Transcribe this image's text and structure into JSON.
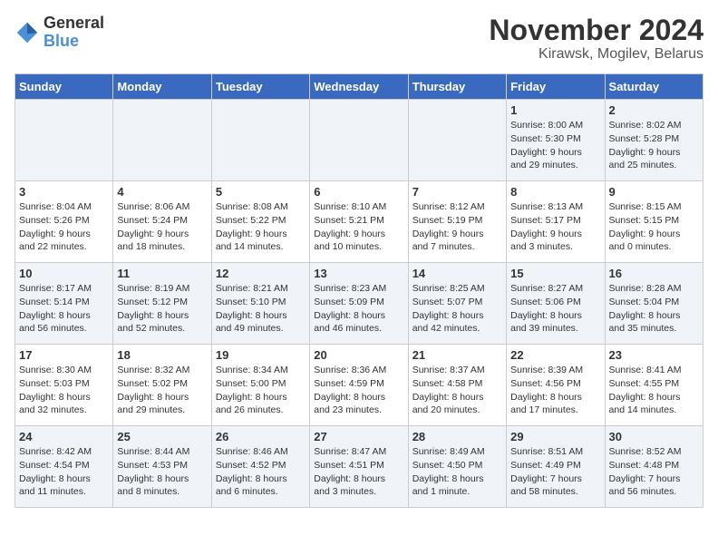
{
  "logo": {
    "general": "General",
    "blue": "Blue"
  },
  "title": {
    "month": "November 2024",
    "location": "Kirawsk, Mogilev, Belarus"
  },
  "weekdays": [
    "Sunday",
    "Monday",
    "Tuesday",
    "Wednesday",
    "Thursday",
    "Friday",
    "Saturday"
  ],
  "weeks": [
    [
      {
        "day": "",
        "info": ""
      },
      {
        "day": "",
        "info": ""
      },
      {
        "day": "",
        "info": ""
      },
      {
        "day": "",
        "info": ""
      },
      {
        "day": "",
        "info": ""
      },
      {
        "day": "1",
        "info": "Sunrise: 8:00 AM\nSunset: 5:30 PM\nDaylight: 9 hours\nand 29 minutes."
      },
      {
        "day": "2",
        "info": "Sunrise: 8:02 AM\nSunset: 5:28 PM\nDaylight: 9 hours\nand 25 minutes."
      }
    ],
    [
      {
        "day": "3",
        "info": "Sunrise: 8:04 AM\nSunset: 5:26 PM\nDaylight: 9 hours\nand 22 minutes."
      },
      {
        "day": "4",
        "info": "Sunrise: 8:06 AM\nSunset: 5:24 PM\nDaylight: 9 hours\nand 18 minutes."
      },
      {
        "day": "5",
        "info": "Sunrise: 8:08 AM\nSunset: 5:22 PM\nDaylight: 9 hours\nand 14 minutes."
      },
      {
        "day": "6",
        "info": "Sunrise: 8:10 AM\nSunset: 5:21 PM\nDaylight: 9 hours\nand 10 minutes."
      },
      {
        "day": "7",
        "info": "Sunrise: 8:12 AM\nSunset: 5:19 PM\nDaylight: 9 hours\nand 7 minutes."
      },
      {
        "day": "8",
        "info": "Sunrise: 8:13 AM\nSunset: 5:17 PM\nDaylight: 9 hours\nand 3 minutes."
      },
      {
        "day": "9",
        "info": "Sunrise: 8:15 AM\nSunset: 5:15 PM\nDaylight: 9 hours\nand 0 minutes."
      }
    ],
    [
      {
        "day": "10",
        "info": "Sunrise: 8:17 AM\nSunset: 5:14 PM\nDaylight: 8 hours\nand 56 minutes."
      },
      {
        "day": "11",
        "info": "Sunrise: 8:19 AM\nSunset: 5:12 PM\nDaylight: 8 hours\nand 52 minutes."
      },
      {
        "day": "12",
        "info": "Sunrise: 8:21 AM\nSunset: 5:10 PM\nDaylight: 8 hours\nand 49 minutes."
      },
      {
        "day": "13",
        "info": "Sunrise: 8:23 AM\nSunset: 5:09 PM\nDaylight: 8 hours\nand 46 minutes."
      },
      {
        "day": "14",
        "info": "Sunrise: 8:25 AM\nSunset: 5:07 PM\nDaylight: 8 hours\nand 42 minutes."
      },
      {
        "day": "15",
        "info": "Sunrise: 8:27 AM\nSunset: 5:06 PM\nDaylight: 8 hours\nand 39 minutes."
      },
      {
        "day": "16",
        "info": "Sunrise: 8:28 AM\nSunset: 5:04 PM\nDaylight: 8 hours\nand 35 minutes."
      }
    ],
    [
      {
        "day": "17",
        "info": "Sunrise: 8:30 AM\nSunset: 5:03 PM\nDaylight: 8 hours\nand 32 minutes."
      },
      {
        "day": "18",
        "info": "Sunrise: 8:32 AM\nSunset: 5:02 PM\nDaylight: 8 hours\nand 29 minutes."
      },
      {
        "day": "19",
        "info": "Sunrise: 8:34 AM\nSunset: 5:00 PM\nDaylight: 8 hours\nand 26 minutes."
      },
      {
        "day": "20",
        "info": "Sunrise: 8:36 AM\nSunset: 4:59 PM\nDaylight: 8 hours\nand 23 minutes."
      },
      {
        "day": "21",
        "info": "Sunrise: 8:37 AM\nSunset: 4:58 PM\nDaylight: 8 hours\nand 20 minutes."
      },
      {
        "day": "22",
        "info": "Sunrise: 8:39 AM\nSunset: 4:56 PM\nDaylight: 8 hours\nand 17 minutes."
      },
      {
        "day": "23",
        "info": "Sunrise: 8:41 AM\nSunset: 4:55 PM\nDaylight: 8 hours\nand 14 minutes."
      }
    ],
    [
      {
        "day": "24",
        "info": "Sunrise: 8:42 AM\nSunset: 4:54 PM\nDaylight: 8 hours\nand 11 minutes."
      },
      {
        "day": "25",
        "info": "Sunrise: 8:44 AM\nSunset: 4:53 PM\nDaylight: 8 hours\nand 8 minutes."
      },
      {
        "day": "26",
        "info": "Sunrise: 8:46 AM\nSunset: 4:52 PM\nDaylight: 8 hours\nand 6 minutes."
      },
      {
        "day": "27",
        "info": "Sunrise: 8:47 AM\nSunset: 4:51 PM\nDaylight: 8 hours\nand 3 minutes."
      },
      {
        "day": "28",
        "info": "Sunrise: 8:49 AM\nSunset: 4:50 PM\nDaylight: 8 hours\nand 1 minute."
      },
      {
        "day": "29",
        "info": "Sunrise: 8:51 AM\nSunset: 4:49 PM\nDaylight: 7 hours\nand 58 minutes."
      },
      {
        "day": "30",
        "info": "Sunrise: 8:52 AM\nSunset: 4:48 PM\nDaylight: 7 hours\nand 56 minutes."
      }
    ]
  ]
}
